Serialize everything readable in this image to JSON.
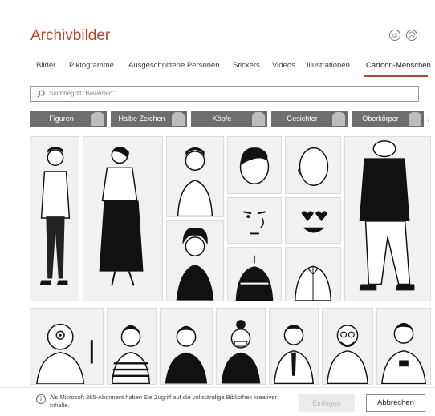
{
  "dialog": {
    "title": "Archivbilder"
  },
  "tabs": [
    {
      "label": "Bilder"
    },
    {
      "label": "Piktogramme"
    },
    {
      "label": "Ausgeschnittene Personen"
    },
    {
      "label": "Stickers"
    },
    {
      "label": "Videos"
    },
    {
      "label": "Illustrationen"
    },
    {
      "label": "Cartoon-Menschen",
      "active": true
    }
  ],
  "search": {
    "placeholder": "Suchbegriff \"Bewerten\""
  },
  "categories": [
    {
      "label": "Figuren"
    },
    {
      "label": "Halbe Zeichen"
    },
    {
      "label": "Köpfe"
    },
    {
      "label": "Gesichter"
    },
    {
      "label": "Oberkörper"
    }
  ],
  "footer": {
    "info_text": "Als Microsoft 365-Abonnent haben Sie Zugriff auf die vollständige Bibliothek kreativer Inhalte.",
    "insert_label": "Einfügen",
    "cancel_label": "Abbrechen"
  },
  "colors": {
    "accent": "#b7472a",
    "category_bg": "#6e6e6e",
    "tile_bg": "#f1f1f1"
  }
}
